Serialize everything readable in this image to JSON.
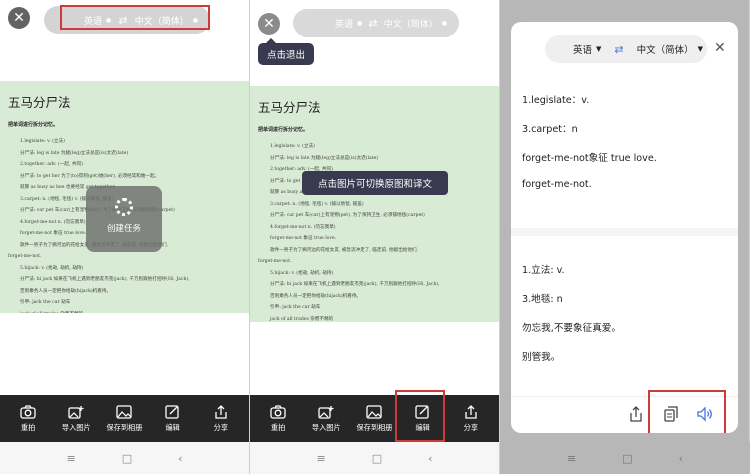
{
  "language_bar": {
    "source": "英语",
    "target": "中文（简体）"
  },
  "document": {
    "title": "五马分尸法",
    "subtitle": "把单词进行拆分记忆。",
    "lines": [
      "1.legislate: v. (立法)",
      "分尸法: leg is late 为腿(leg)立法总是(is)太迟(late)",
      "2.together: adv. (一起, 共同)",
      "分尸法: to get her 为了(to)得到(get)她(her), 必须经常和她一起。",
      "就算 as busy as bee 也要经常 get together",
      "3.carpet: n. (地毯, 毛毯) v. (铺以地毯, 铺盖)",
      "分尸法: car pet 车(car)上有宠物(pet), 为了保持卫生, 必须铺地毯(carpet)",
      "4.forget-me-not n. (勿忘我草)",
      "forget-me-not 象征 true love.",
      "歌件一男子为了摘河边的花给女友, 被急流冲走了, 临走前, 他献出给他们,",
      "forget-me-not.",
      "5.hijack: v. (抢劫, 劫机, 劫持)",
      "分尸法: hi jack 如果在飞机上遇到老朋友杰克(jack), 千万别跟他打招呼(Hi, Jack),",
      "否则乘务人员一定把你给劫(hijack)机看待。",
      "引申: jack the car 劫车",
      "jack of all trades 杂而不精的"
    ]
  },
  "toolbar": {
    "retake": "重拍",
    "import": "导入图片",
    "save_album": "保存到相册",
    "edit": "编辑",
    "share": "分享"
  },
  "loading": {
    "label": "创建任务"
  },
  "tips": {
    "exit": "点击退出",
    "switch": "点击图片可切换原图和译文"
  },
  "translation": {
    "source_lines": [
      "1.legislate：v.",
      "3.carpet：n",
      "forget-me-not象征 true love.",
      "forget-me-not."
    ],
    "target_lines": [
      "1.立法: v.",
      "3.地毯: n",
      "勿忘我,不要象征真爱。",
      "别管我。"
    ]
  },
  "icons": {
    "close": "close-icon",
    "swap": "swap-icon",
    "share": "share-icon",
    "copy": "copy-icon",
    "speaker": "speaker-icon"
  },
  "colors": {
    "highlight_box": "#cc3b3b",
    "doc_bg": "#d8ebd4",
    "accent": "#4a74e0",
    "toolbar_bg": "#262626"
  }
}
